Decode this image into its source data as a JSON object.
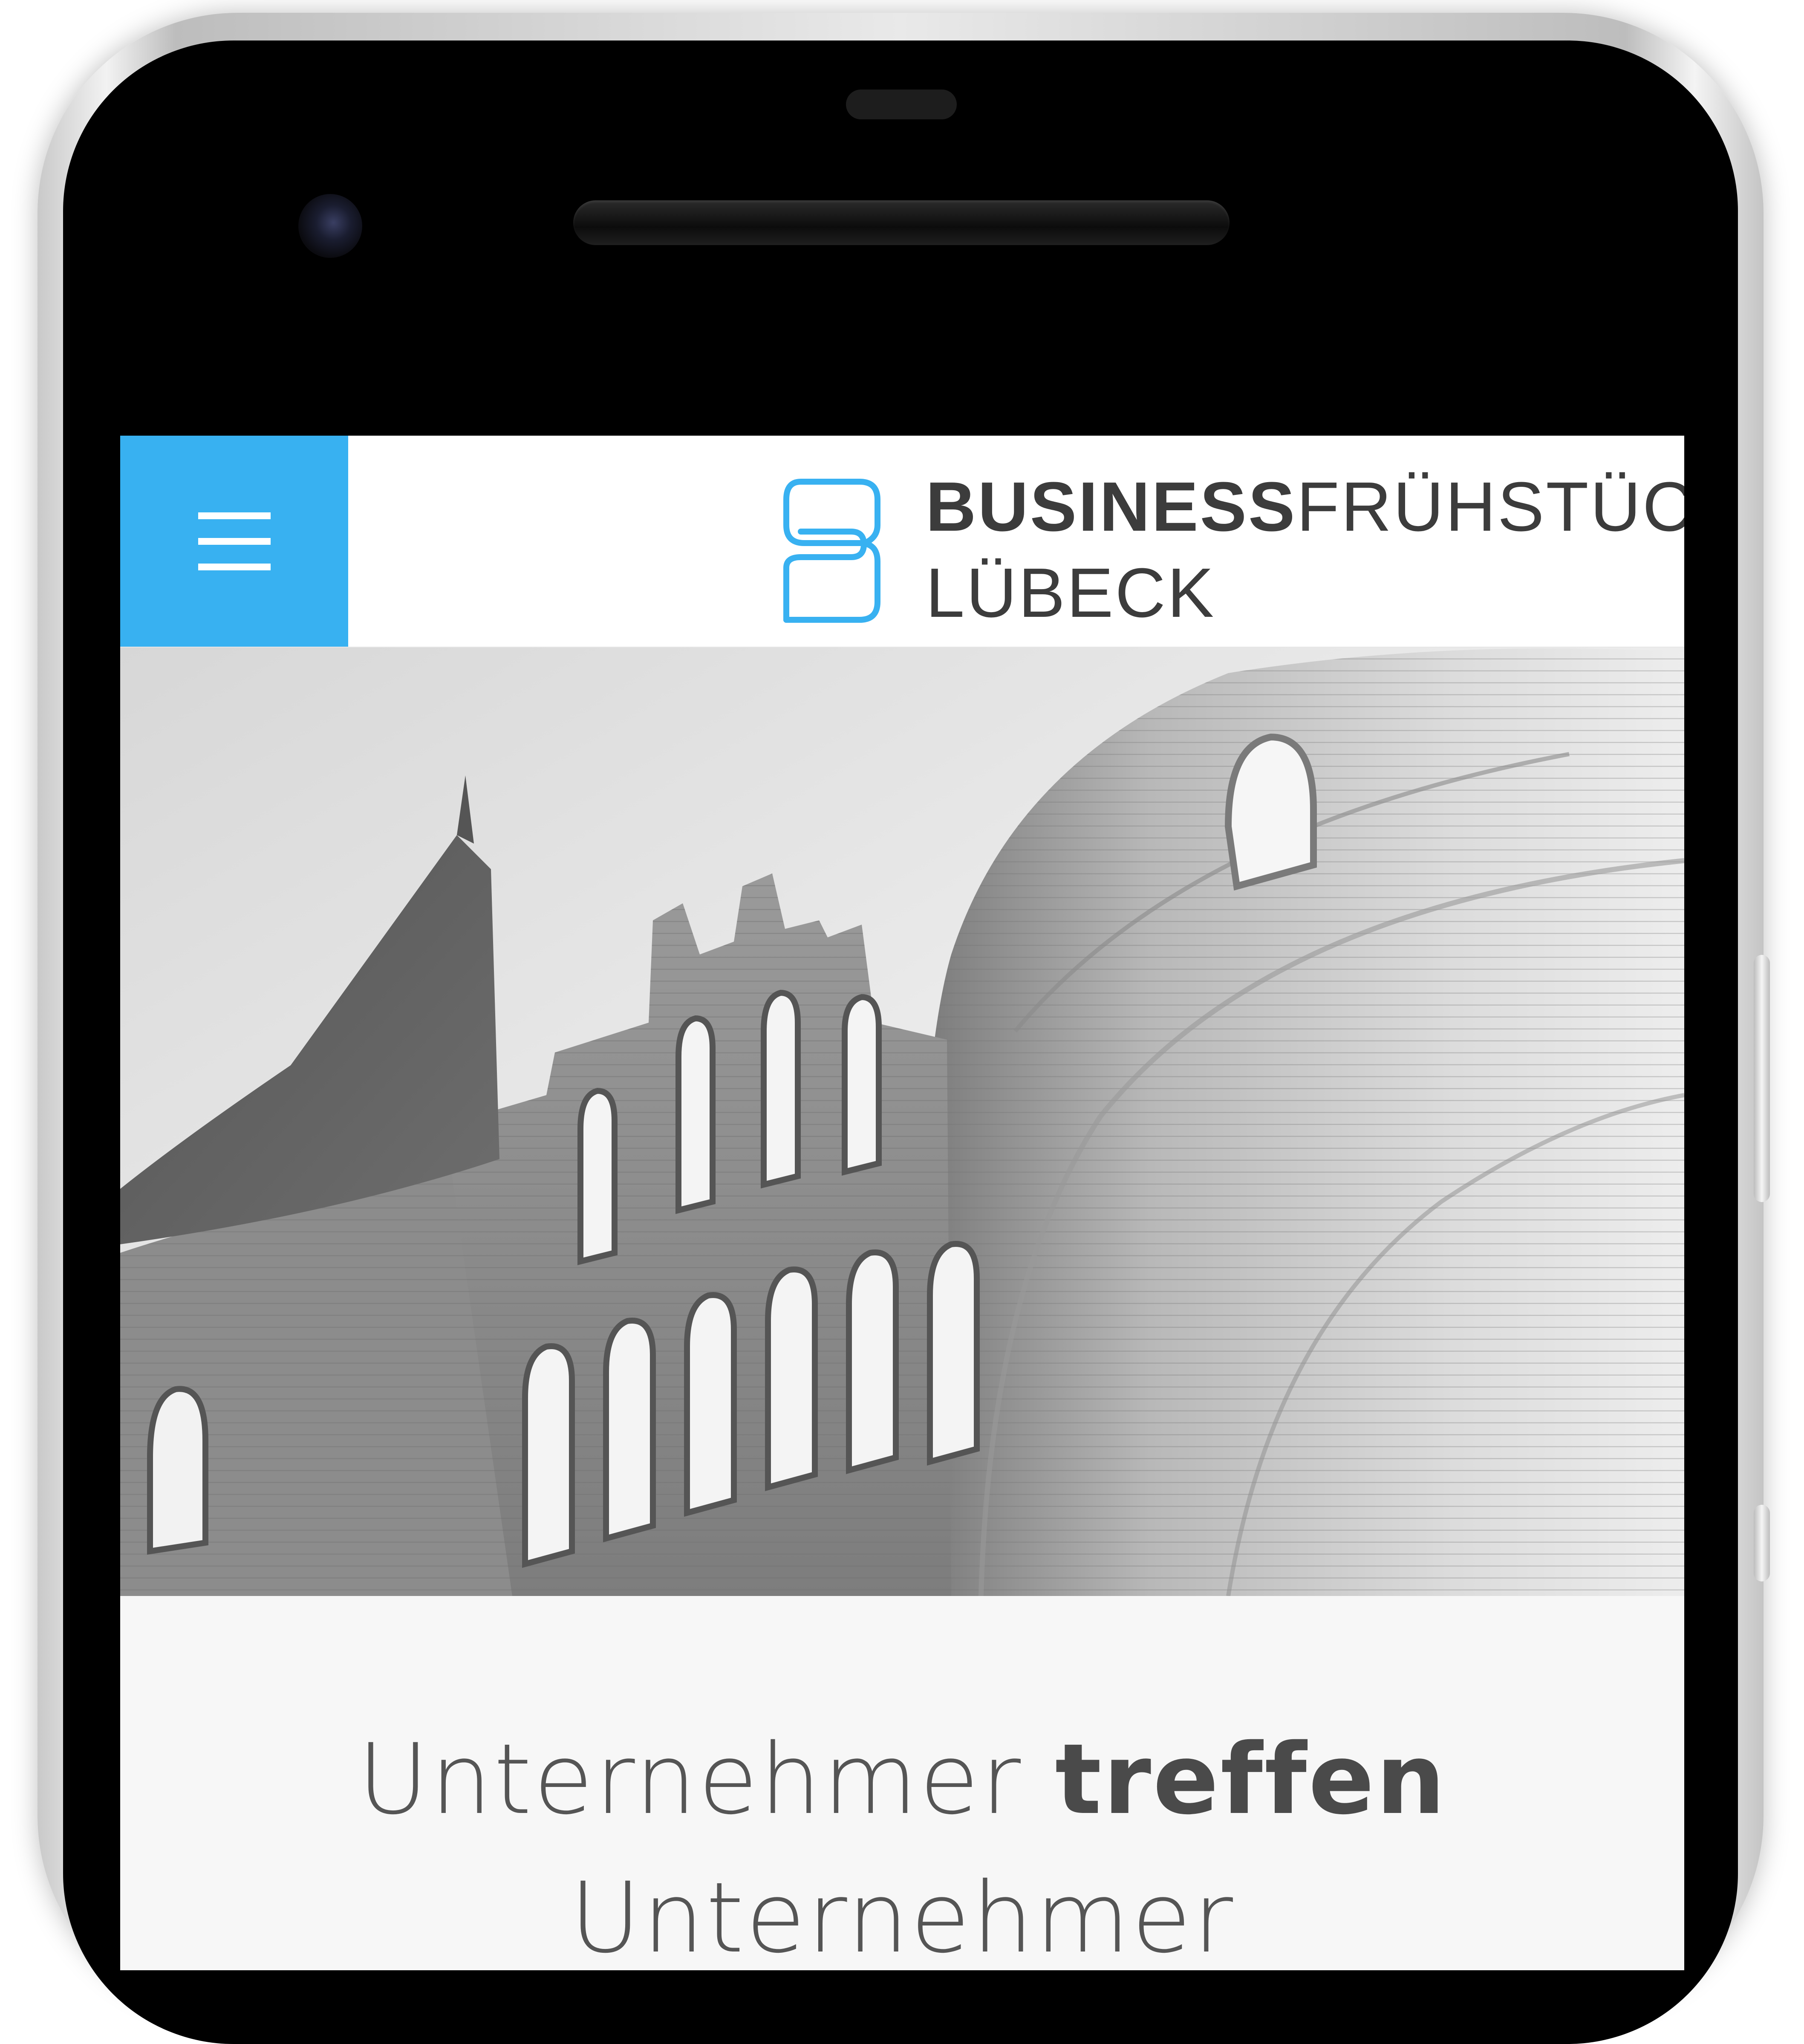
{
  "header": {
    "brand_bold": "BUSINESS",
    "brand_light": "FRÜHSTÜCK",
    "brand_city": "LÜBECK"
  },
  "main": {
    "headline_part1": "Unternehmer",
    "headline_bold": "treffen",
    "headline_part2": "Unternehmer"
  },
  "colors": {
    "accent": "#38b1f1",
    "text": "#3c3c3c"
  },
  "icons": {
    "menu": "hamburger-menu-icon",
    "logo": "s-logo-icon"
  }
}
